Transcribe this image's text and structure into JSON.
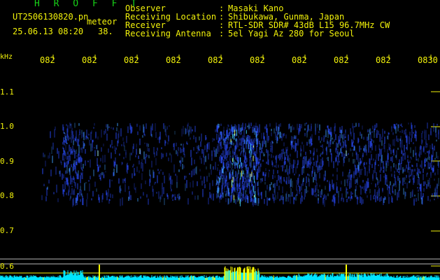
{
  "header": {
    "app_title": "H R O F F T",
    "file_name": "UT2506130820.pn",
    "type_label": "meteor",
    "datetime": "25.06.13 08:20",
    "count": "38."
  },
  "info": [
    {
      "label": "Observer",
      "value": "Masaki Kano"
    },
    {
      "label": "Receiving Location",
      "value": "Shibukawa, Gunma, Japan"
    },
    {
      "label": "Receiver",
      "value": "RTL-SDR SDR# 43dB L15 96.7MHz CW"
    },
    {
      "label": "Receiving Antenna",
      "value": "5el Yagi Az 280 for Seoul"
    }
  ],
  "x_ticks": [
    "082",
    "082",
    "082",
    "082",
    "082",
    "082",
    "082",
    "082",
    "082",
    "0830"
  ],
  "y_unit": "kHz",
  "y_ticks": [
    "1.1",
    "1.0",
    "0.9",
    "0.8",
    "0.7",
    "0.6"
  ],
  "colors": {
    "text": "#f2f20a",
    "title": "#18d418",
    "signal": "#2a4cff",
    "hot": "#ffff00",
    "trace": "#00e5ff"
  }
}
